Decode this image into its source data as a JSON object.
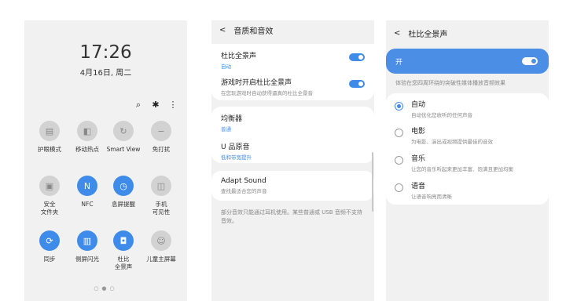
{
  "panel1": {
    "time": "17:26",
    "date": "4月16日, 周二",
    "toolbar": {
      "search_icon": "⌕",
      "gear_icon": "✱",
      "more_icon": "⋮"
    },
    "tiles": [
      {
        "label": "护眼模式",
        "icon": "▤",
        "on": false
      },
      {
        "label": "移动热点",
        "icon": "◧",
        "on": false
      },
      {
        "label": "Smart View",
        "icon": "↻",
        "on": false
      },
      {
        "label": "免打扰",
        "icon": "−",
        "on": false
      },
      {
        "label": "安全\n文件夹",
        "icon": "▣",
        "on": false
      },
      {
        "label": "NFC",
        "icon": "N",
        "on": true
      },
      {
        "label": "息屏提醒",
        "icon": "◷",
        "on": true
      },
      {
        "label": "手机\n可见性",
        "icon": "◫",
        "on": false
      },
      {
        "label": "同步",
        "icon": "⟳",
        "on": true
      },
      {
        "label": "侧屏闪光",
        "icon": "▥",
        "on": true
      },
      {
        "label": "杜比\n全景声",
        "icon": "◘",
        "on": true
      },
      {
        "label": "儿童主屏幕",
        "icon": "☺",
        "on": false
      }
    ],
    "page_dots": "○●○"
  },
  "panel2": {
    "title": "音质和音效",
    "rows": [
      {
        "title": "杜比全景声",
        "sub": "自动",
        "toggle": true
      },
      {
        "title": "游戏时开启杜比全景声",
        "sub": "在您玩游戏时自动获得逼真的杜比全景音",
        "toggle": true
      },
      {
        "title": "均衡器",
        "sub": "普通",
        "toggle": false
      },
      {
        "title": "U 品原音",
        "sub": "低和带宽提升",
        "toggle": false
      },
      {
        "title": "Adapt Sound",
        "sub": "查找最适合您的声音",
        "toggle": false
      }
    ],
    "note": "部分音效只能通过耳机使用。某些普通或 USB 音频不支持音效。"
  },
  "panel3": {
    "title": "杜比全景声",
    "master_label": "开",
    "description": "体验在您四周环绕的突破性媒体播放音频效果",
    "options": [
      {
        "title": "自动",
        "sub": "自动优化您收听的任何声音",
        "selected": true
      },
      {
        "title": "电影",
        "sub": "为电影、演出或视频提供最佳的音效",
        "selected": false
      },
      {
        "title": "音乐",
        "sub": "让您的音乐听起来更加丰富、饱满且更加均衡",
        "selected": false
      },
      {
        "title": "语音",
        "sub": "让语音响亮而清晰",
        "selected": false
      }
    ]
  },
  "colors": {
    "accent": "#3f8bea",
    "panel_bg": "#f1f1f1"
  }
}
